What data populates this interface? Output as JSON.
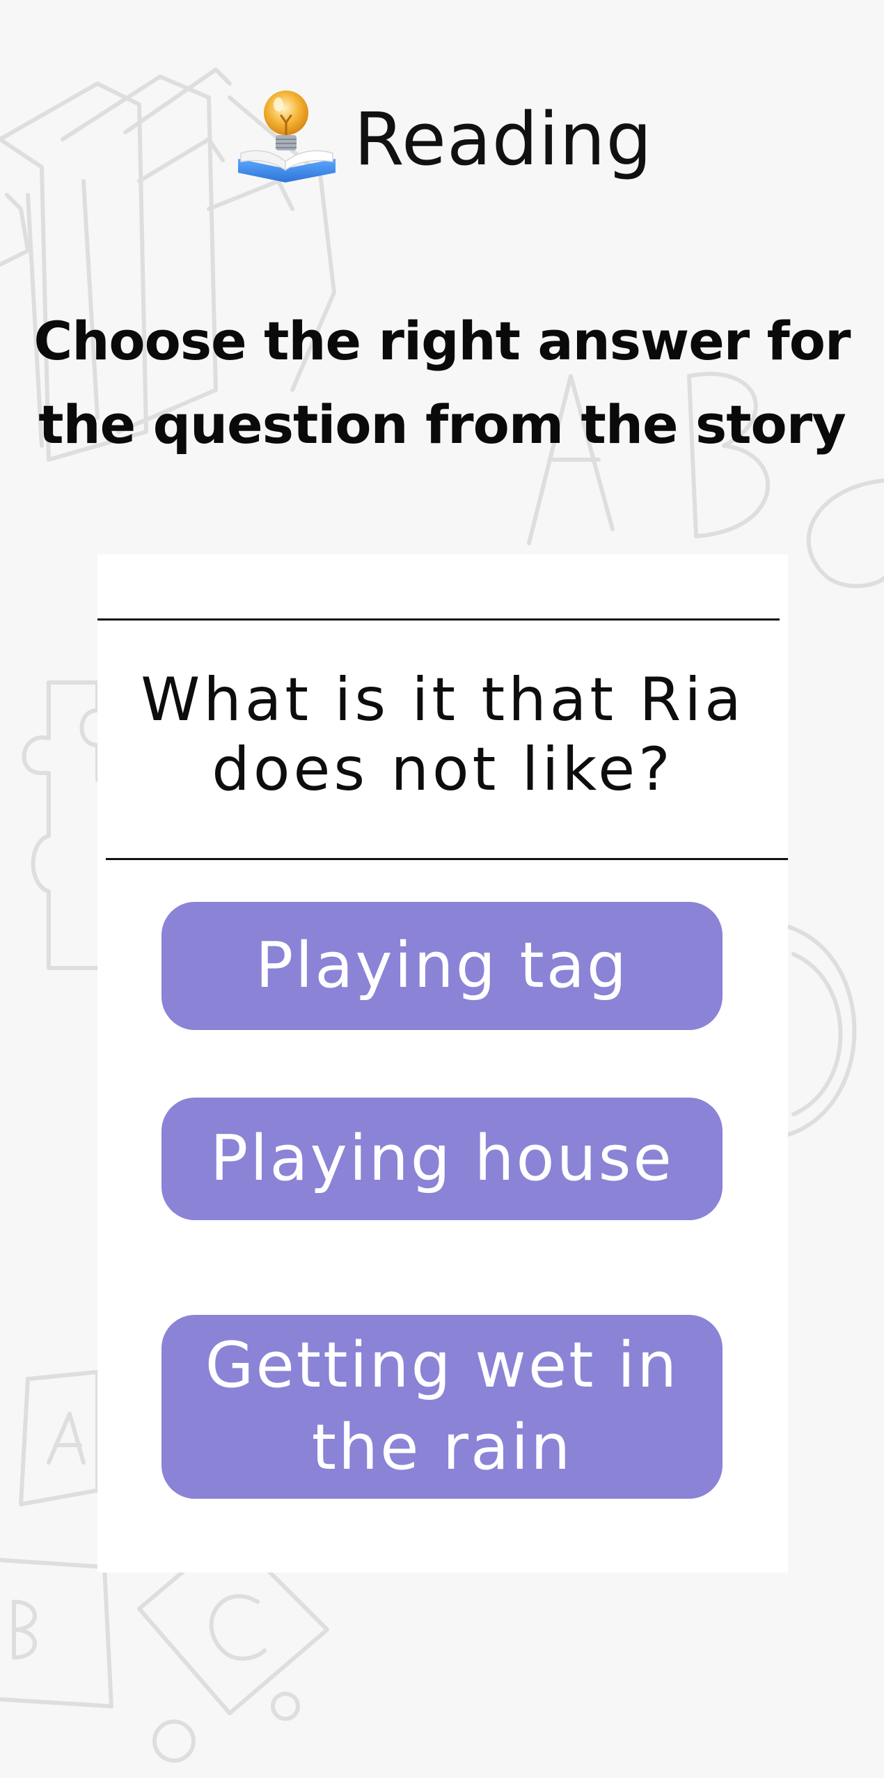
{
  "header": {
    "title": "Reading",
    "icon": "reading-book-lightbulb-icon"
  },
  "instruction": "Choose the right answer for the question from the story",
  "question": "What is it that Ria does not like?",
  "answers": [
    {
      "label": "Playing tag"
    },
    {
      "label": "Playing house"
    },
    {
      "label": "Getting wet in the rain"
    }
  ],
  "colors": {
    "background": "#f7f7f7",
    "card": "#ffffff",
    "answer_button": "#8a83d6",
    "answer_text": "#ffffff",
    "text": "#111111",
    "doodle": "#dddddd"
  }
}
